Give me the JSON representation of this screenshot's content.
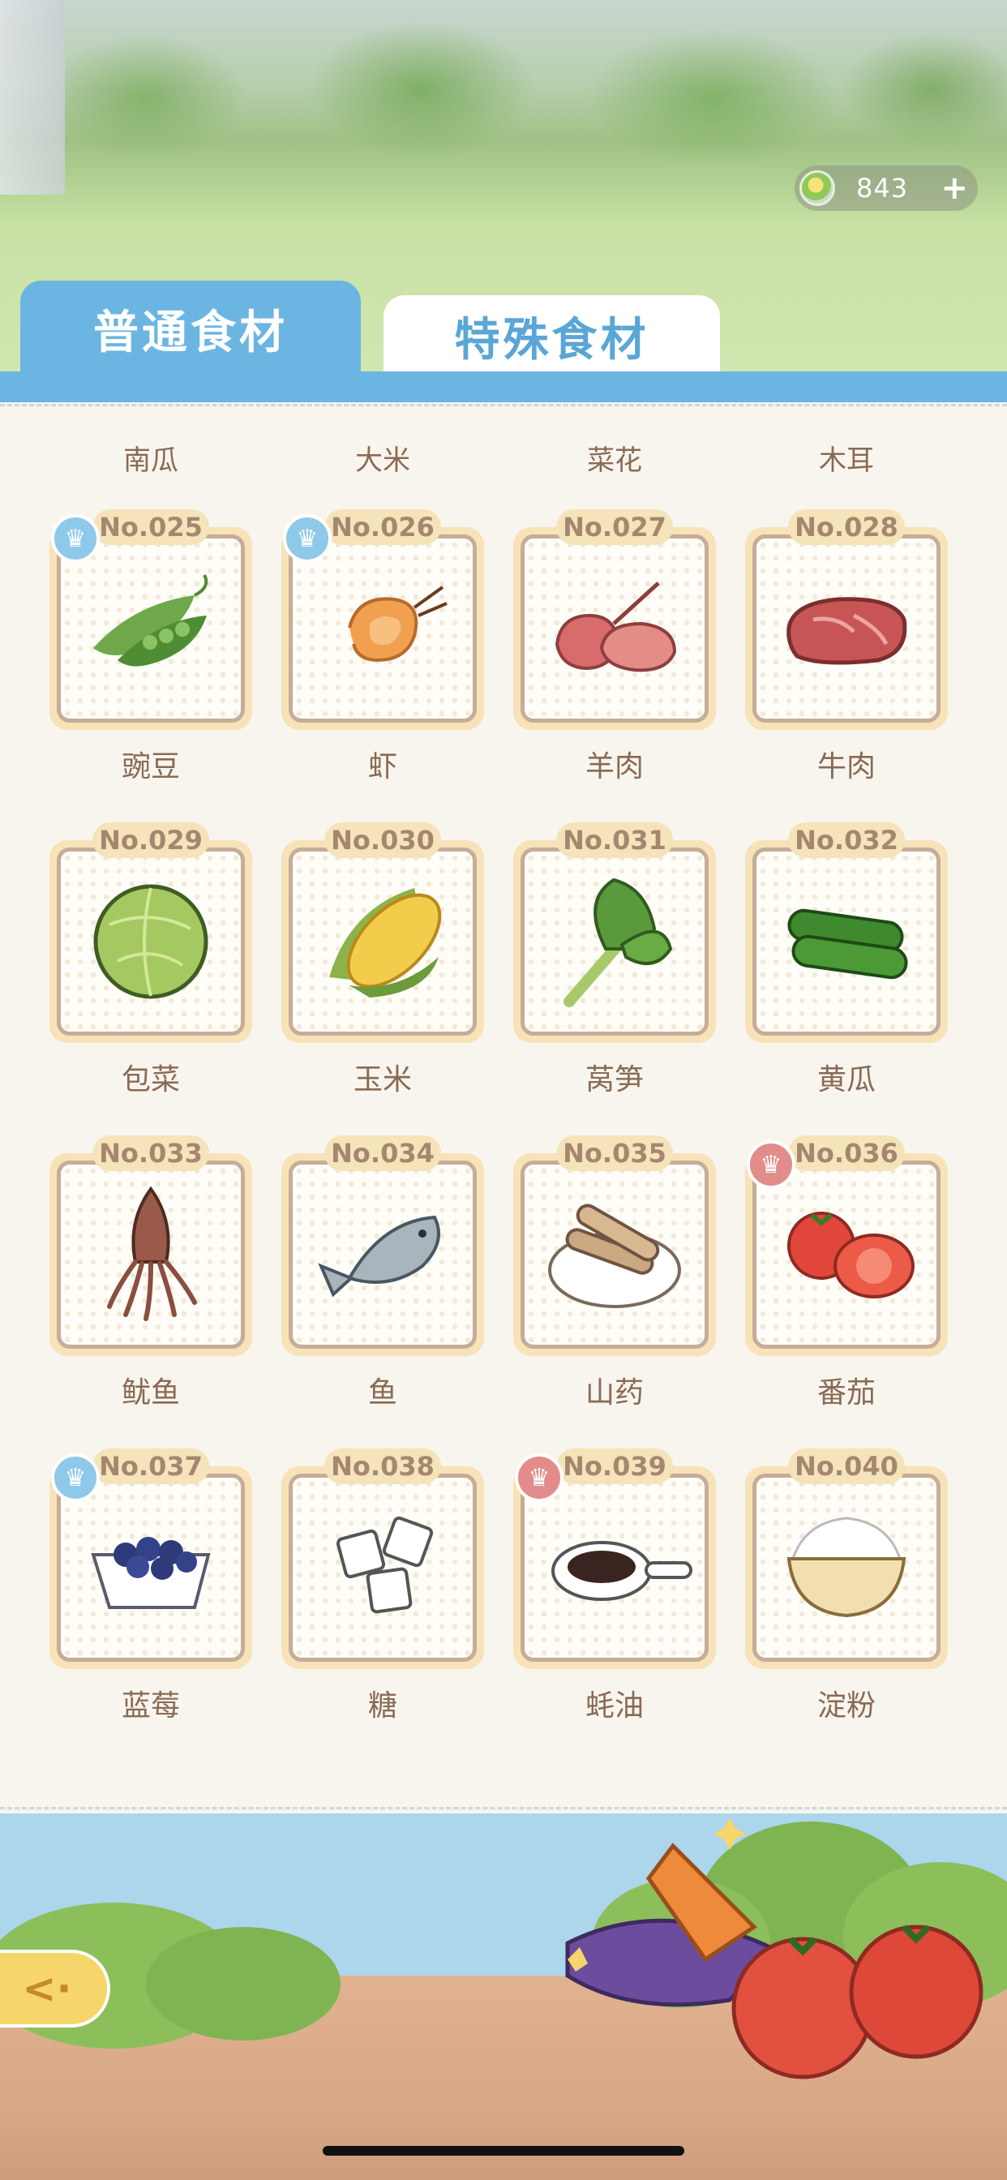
{
  "header": {
    "currency_value": "843",
    "currency_icon": "coin-icon",
    "add_icon": "plus-icon"
  },
  "tabs": [
    {
      "label": "普通食材",
      "active": true
    },
    {
      "label": "特殊食材",
      "active": false
    }
  ],
  "previous_row_labels": [
    "南瓜",
    "大米",
    "菜花",
    "木耳"
  ],
  "ingredients": [
    {
      "no": "No.025",
      "name": "豌豆",
      "chef": "blue",
      "icon": "pea-pod-icon"
    },
    {
      "no": "No.026",
      "name": "虾",
      "chef": "blue",
      "icon": "shrimp-icon"
    },
    {
      "no": "No.027",
      "name": "羊肉",
      "chef": "",
      "icon": "lamb-icon"
    },
    {
      "no": "No.028",
      "name": "牛肉",
      "chef": "",
      "icon": "beef-icon"
    },
    {
      "no": "No.029",
      "name": "包菜",
      "chef": "",
      "icon": "cabbage-icon"
    },
    {
      "no": "No.030",
      "name": "玉米",
      "chef": "",
      "icon": "corn-icon"
    },
    {
      "no": "No.031",
      "name": "莴笋",
      "chef": "",
      "icon": "lettuce-stem-icon"
    },
    {
      "no": "No.032",
      "name": "黄瓜",
      "chef": "",
      "icon": "cucumber-icon"
    },
    {
      "no": "No.033",
      "name": "鱿鱼",
      "chef": "",
      "icon": "squid-icon"
    },
    {
      "no": "No.034",
      "name": "鱼",
      "chef": "",
      "icon": "fish-icon"
    },
    {
      "no": "No.035",
      "name": "山药",
      "chef": "",
      "icon": "yam-icon"
    },
    {
      "no": "No.036",
      "name": "番茄",
      "chef": "red",
      "icon": "tomato-icon"
    },
    {
      "no": "No.037",
      "name": "蓝莓",
      "chef": "blue",
      "icon": "blueberry-icon"
    },
    {
      "no": "No.038",
      "name": "糖",
      "chef": "",
      "icon": "sugar-cube-icon"
    },
    {
      "no": "No.039",
      "name": "蚝油",
      "chef": "red",
      "icon": "oyster-sauce-icon"
    },
    {
      "no": "No.040",
      "name": "淀粉",
      "chef": "",
      "icon": "starch-bowl-icon"
    }
  ],
  "colors": {
    "tab_active": "#6bb5e3",
    "card_frame": "#f8e2b8",
    "text_brown": "#8a6a53",
    "chef_blue": "#8fc9ea",
    "chef_red": "#e28c8c"
  },
  "footer": {
    "back_icon": "back-arrow-icon"
  }
}
